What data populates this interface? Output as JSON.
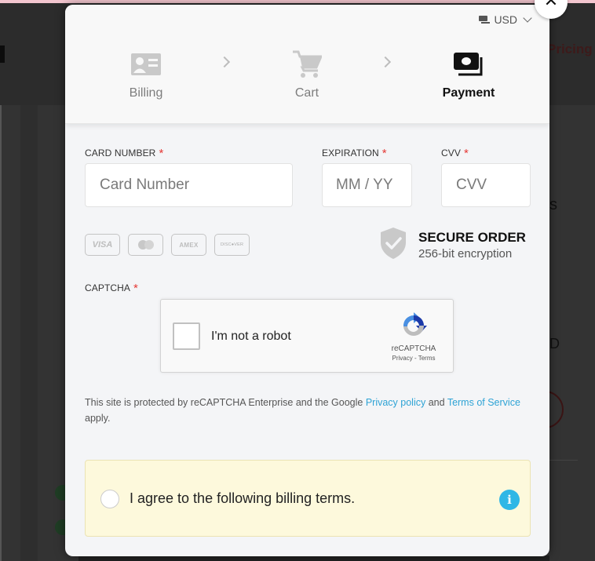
{
  "background": {
    "nav_link": "Pricing",
    "partial_text_1": "s",
    "partial_text_2": "D"
  },
  "header": {
    "currency": "USD",
    "currency_icon": "money-icon",
    "close_icon": "close-icon",
    "close_label": "✕",
    "steps": [
      {
        "label": "Billing",
        "icon": "id-card-icon",
        "active": false
      },
      {
        "label": "Cart",
        "icon": "cart-icon",
        "active": false
      },
      {
        "label": "Payment",
        "icon": "money-bill-icon",
        "active": true
      }
    ]
  },
  "form": {
    "card_number": {
      "label": "CARD NUMBER",
      "required": "*",
      "placeholder": "Card Number",
      "value": ""
    },
    "expiration": {
      "label": "EXPIRATION",
      "required": "*",
      "placeholder": "MM / YY",
      "value": ""
    },
    "cvv": {
      "label": "CVV",
      "required": "*",
      "placeholder": "CVV",
      "value": ""
    },
    "card_brands": [
      "VISA",
      "MASTERCARD",
      "AMEX",
      "DISCOVER"
    ],
    "card_brand_labels": {
      "visa": "VISA",
      "amex": "AMEX",
      "discover": "DISC●VER"
    },
    "secure": {
      "title": "SECURE ORDER",
      "subtitle": "256-bit encryption",
      "icon": "shield-check-icon"
    },
    "captcha": {
      "label": "CAPTCHA",
      "required": "*",
      "checkbox_text": "I'm not a robot",
      "brand": "reCAPTCHA",
      "links": "Privacy - Terms",
      "checked": false
    },
    "notice": {
      "before": "This site is protected by reCAPTCHA Enterprise and the Google ",
      "privacy_link": "Privacy policy",
      "middle": " and ",
      "terms_link": "Terms of Service",
      "after": " apply."
    },
    "terms": {
      "label": "I agree to the following billing terms.",
      "checked": false,
      "info_icon": "i"
    }
  },
  "colors": {
    "required": "#e53935",
    "link": "#2ea3d5",
    "info": "#2fb7e6",
    "terms_bg": "#fdf9dc",
    "overlay": "#333333"
  }
}
